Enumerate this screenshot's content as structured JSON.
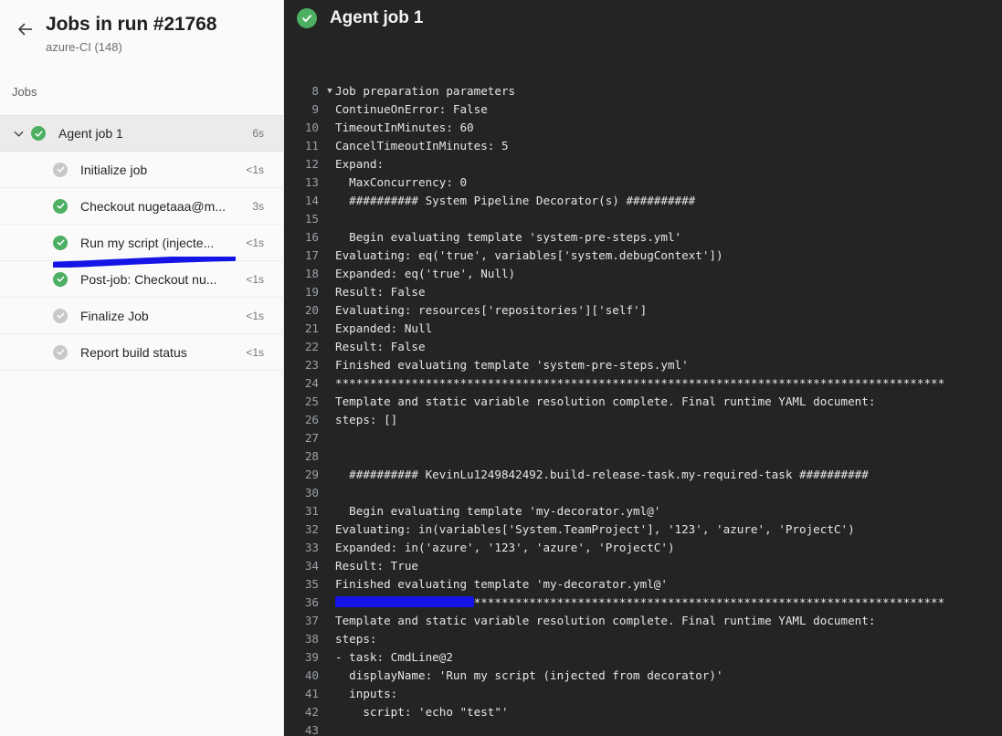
{
  "sidebar": {
    "back_icon": "arrow-left-icon",
    "run_title": "Jobs in run #21768",
    "run_subtitle": "azure-CI (148)",
    "section_label": "Jobs",
    "jobs": [
      {
        "name": "Agent job 1",
        "duration": "6s",
        "status": "ok",
        "level": "parent",
        "selected": true,
        "chevron": "chevron-down-icon"
      },
      {
        "name": "Initialize job",
        "duration": "<1s",
        "status": "skip",
        "level": "child",
        "selected": false,
        "chevron": ""
      },
      {
        "name": "Checkout nugetaaa@m...",
        "duration": "3s",
        "status": "ok",
        "level": "child",
        "selected": false,
        "chevron": ""
      },
      {
        "name": "Run my script (injecte...",
        "duration": "<1s",
        "status": "ok",
        "level": "child",
        "selected": false,
        "chevron": ""
      },
      {
        "name": "Post-job: Checkout nu...",
        "duration": "<1s",
        "status": "ok",
        "level": "child",
        "selected": false,
        "chevron": ""
      },
      {
        "name": "Finalize Job",
        "duration": "<1s",
        "status": "skip",
        "level": "child",
        "selected": false,
        "chevron": ""
      },
      {
        "name": "Report build status",
        "duration": "<1s",
        "status": "skip",
        "level": "child",
        "selected": false,
        "chevron": ""
      }
    ]
  },
  "main": {
    "status": "ok",
    "title": "Agent job 1",
    "lines": [
      {
        "n": "8",
        "fold": "▼",
        "text": "Job preparation parameters"
      },
      {
        "n": "9",
        "fold": "",
        "text": "ContinueOnError: False"
      },
      {
        "n": "10",
        "fold": "",
        "text": "TimeoutInMinutes: 60"
      },
      {
        "n": "11",
        "fold": "",
        "text": "CancelTimeoutInMinutes: 5"
      },
      {
        "n": "12",
        "fold": "",
        "text": "Expand:"
      },
      {
        "n": "13",
        "fold": "",
        "text": "  MaxConcurrency: 0"
      },
      {
        "n": "14",
        "fold": "",
        "text": "  ########## System Pipeline Decorator(s) ##########"
      },
      {
        "n": "15",
        "fold": "",
        "text": ""
      },
      {
        "n": "16",
        "fold": "",
        "text": "  Begin evaluating template 'system-pre-steps.yml'"
      },
      {
        "n": "17",
        "fold": "",
        "text": "Evaluating: eq('true', variables['system.debugContext'])"
      },
      {
        "n": "18",
        "fold": "",
        "text": "Expanded: eq('true', Null)"
      },
      {
        "n": "19",
        "fold": "",
        "text": "Result: False"
      },
      {
        "n": "20",
        "fold": "",
        "text": "Evaluating: resources['repositories']['self']"
      },
      {
        "n": "21",
        "fold": "",
        "text": "Expanded: Null"
      },
      {
        "n": "22",
        "fold": "",
        "text": "Result: False"
      },
      {
        "n": "23",
        "fold": "",
        "text": "Finished evaluating template 'system-pre-steps.yml'"
      },
      {
        "n": "24",
        "fold": "",
        "text": "****************************************************************************************"
      },
      {
        "n": "25",
        "fold": "",
        "text": "Template and static variable resolution complete. Final runtime YAML document:"
      },
      {
        "n": "26",
        "fold": "",
        "text": "steps: []"
      },
      {
        "n": "27",
        "fold": "",
        "text": ""
      },
      {
        "n": "28",
        "fold": "",
        "text": ""
      },
      {
        "n": "29",
        "fold": "",
        "text": "  ########## KevinLu1249842492.build-release-task.my-required-task ##########"
      },
      {
        "n": "30",
        "fold": "",
        "text": ""
      },
      {
        "n": "31",
        "fold": "",
        "text": "  Begin evaluating template 'my-decorator.yml@'"
      },
      {
        "n": "32",
        "fold": "",
        "text": "Evaluating: in(variables['System.TeamProject'], '123', 'azure', 'ProjectC')"
      },
      {
        "n": "33",
        "fold": "",
        "text": "Expanded: in('azure', '123', 'azure', 'ProjectC')"
      },
      {
        "n": "34",
        "fold": "",
        "text": "Result: True"
      },
      {
        "n": "35",
        "fold": "",
        "text": "Finished evaluating template 'my-decorator.yml@'"
      },
      {
        "n": "36",
        "fold": "",
        "text": "****************************************************************************************",
        "redacted": true
      },
      {
        "n": "37",
        "fold": "",
        "text": "Template and static variable resolution complete. Final runtime YAML document:"
      },
      {
        "n": "38",
        "fold": "",
        "text": "steps:"
      },
      {
        "n": "39",
        "fold": "",
        "text": "- task: CmdLine@2"
      },
      {
        "n": "40",
        "fold": "",
        "text": "  displayName: 'Run my script (injected from decorator)'"
      },
      {
        "n": "41",
        "fold": "",
        "text": "  inputs:"
      },
      {
        "n": "42",
        "fold": "",
        "text": "    script: 'echo \"test\"'"
      },
      {
        "n": "43",
        "fold": "",
        "text": ""
      }
    ]
  },
  "colors": {
    "log_background": "#242424",
    "sidebar_background": "#fafafa",
    "selected_row": "#ebebeb",
    "status_success": "#4caf62",
    "status_skipped": "#c8c8c8",
    "annotation_blue": "#1414e6"
  }
}
